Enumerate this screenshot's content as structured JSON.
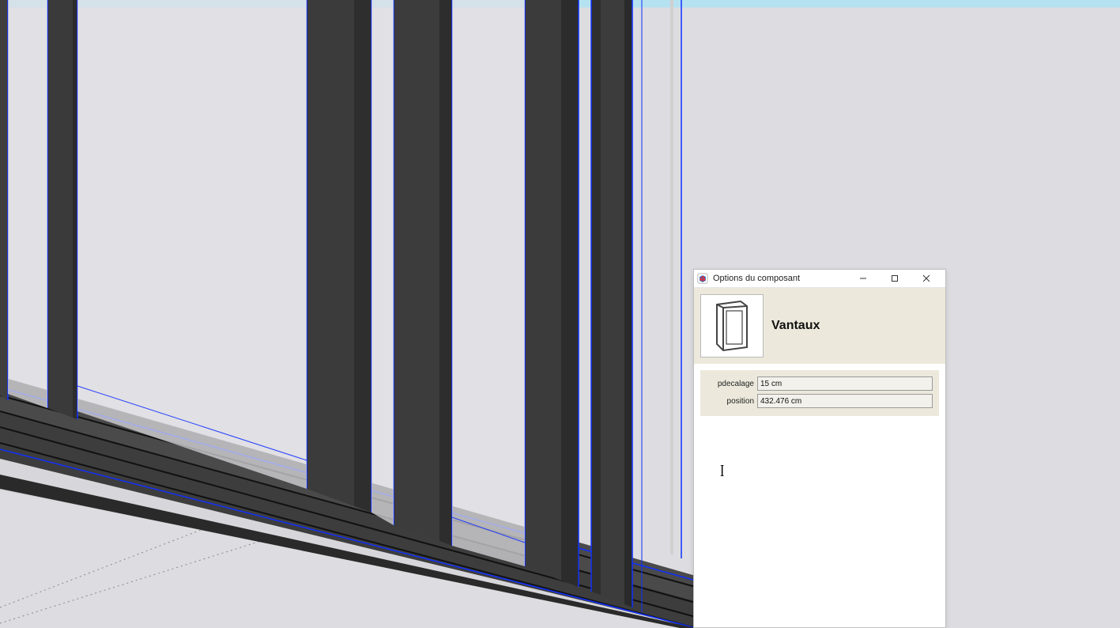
{
  "dialog": {
    "title": "Options du composant",
    "component_name": "Vantaux",
    "properties": [
      {
        "label": "pdecalage",
        "value": "15 cm"
      },
      {
        "label": "position",
        "value": "432.476 cm"
      }
    ]
  }
}
